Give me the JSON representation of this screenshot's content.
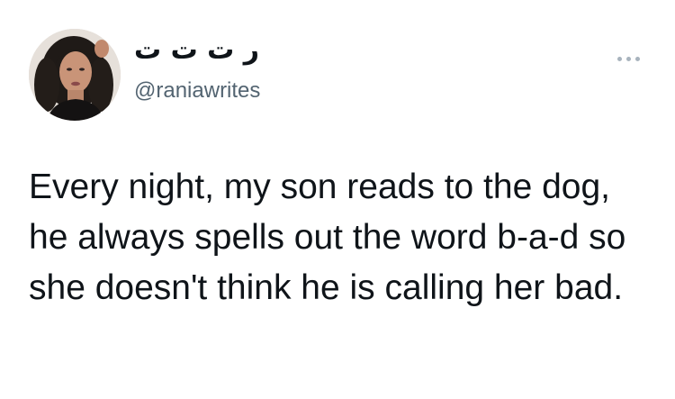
{
  "tweet": {
    "author": {
      "display_name": "ر ت ت ت",
      "handle": "@raniawrites",
      "avatar_icon": "profile-photo"
    },
    "more_icon": "more-horizontal-icon",
    "text": "Every night, my son reads to the dog, he always spells out the word b-a-d so she doesn't think he is calling her bad."
  },
  "colors": {
    "background": "#ffffff",
    "text": "#0f1419",
    "secondary_text": "#536471",
    "more_icon": "#a8b3bd"
  }
}
